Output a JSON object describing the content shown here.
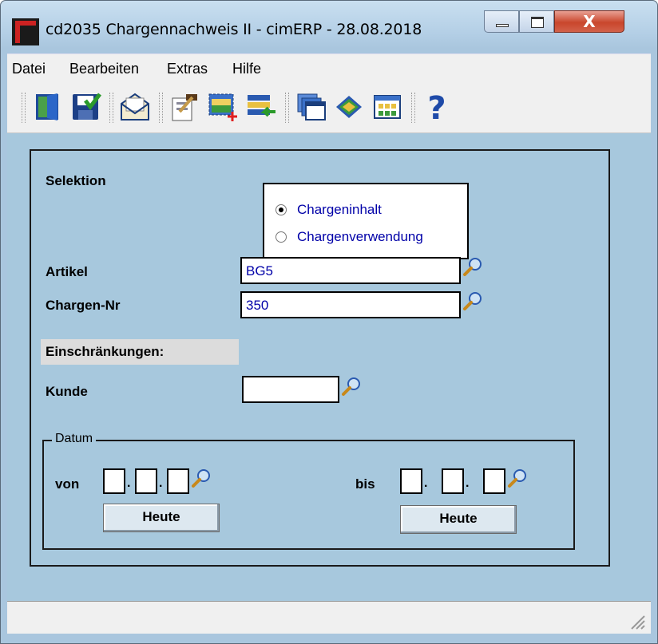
{
  "window": {
    "title": "cd2035 Chargennachweis II - cimERP - 28.08.2018",
    "close_glyph": "X"
  },
  "menu": [
    {
      "label": "Datei"
    },
    {
      "label": "Bearbeiten"
    },
    {
      "label": "Extras"
    },
    {
      "label": "Hilfe"
    }
  ],
  "toolbar": {
    "icons": [
      "exit-door-icon",
      "save-icon",
      "mail-icon",
      "edit-icon",
      "new-selection-icon",
      "import-list-icon",
      "windows-icon",
      "book-icon",
      "grid-icon",
      "help-icon"
    ],
    "help_glyph": "?"
  },
  "form": {
    "selektion_label": "Selektion",
    "radios": [
      {
        "label": "Chargeninhalt",
        "checked": true
      },
      {
        "label": "Chargenverwendung",
        "checked": false
      }
    ],
    "artikel_label": "Artikel",
    "artikel_value": "BG5",
    "chargen_label": "Chargen-Nr",
    "chargen_value": "350",
    "restrictions_heading": "Einschränkungen:",
    "kunde_label": "Kunde",
    "kunde_value": "",
    "datum_legend": "Datum",
    "von_label": "von",
    "bis_label": "bis",
    "date_separator": ".",
    "heute_label": "Heute"
  },
  "colors": {
    "client_bg": "#a7c8dd",
    "input_text": "#0000a8",
    "close_button": "#c9462c"
  }
}
